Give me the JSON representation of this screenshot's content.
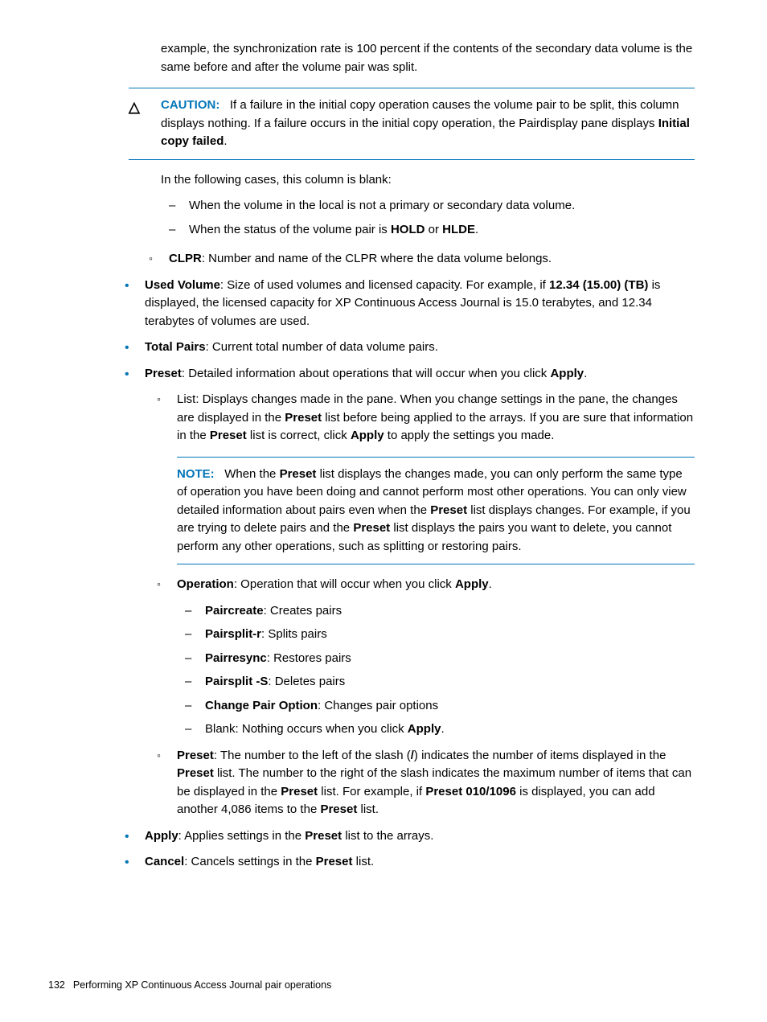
{
  "intro": "example, the synchronization rate is 100 percent if the contents of the secondary data volume is the same before and after the volume pair was split.",
  "caution": {
    "label": "CAUTION:",
    "text1": "If a failure in the initial copy operation causes the volume pair to be split, this column displays nothing. If a failure occurs in the initial copy operation, the Pairdisplay pane displays ",
    "bold1": "Initial copy failed",
    "text2": "."
  },
  "cases": {
    "intro": "In the following cases, this column is blank:",
    "items": [
      "When the volume in the local is not a primary or secondary data volume.",
      {
        "pre": "When the status of the volume pair is ",
        "b1": "HOLD",
        "mid": " or ",
        "b2": "HLDE",
        "post": "."
      }
    ]
  },
  "clpr": {
    "bold": "CLPR",
    "text": ": Number and name of the CLPR where the data volume belongs."
  },
  "usedVol": {
    "b1": "Used Volume",
    "t1": ": Size of used volumes and licensed capacity. For example, if ",
    "b2": "12.34 (15.00) (TB)",
    "t2": " is displayed, the licensed capacity for XP Continuous Access Journal is 15.0 terabytes, and 12.34 terabytes of volumes are used."
  },
  "totalPairs": {
    "b": "Total Pairs",
    "t": ": Current total number of data volume pairs."
  },
  "preset": {
    "b1": "Preset",
    "t1": ": Detailed information about operations that will occur when you click ",
    "b2": "Apply",
    "t2": ".",
    "listItem": {
      "t1": "List: Displays changes made in the pane. When you change settings in the pane, the changes are displayed in the ",
      "b1": "Preset",
      "t2": " list before being applied to the arrays. If you are sure that information in the ",
      "b2": "Preset",
      "t3": " list is correct, click ",
      "b3": "Apply",
      "t4": " to apply the settings you made."
    },
    "note": {
      "label": "NOTE:",
      "t1": "When the ",
      "b1": "Preset",
      "t2": " list displays the changes made, you can only perform the same type of operation you have been doing and cannot perform most other operations. You can only view detailed information about pairs even when the ",
      "b2": "Preset",
      "t3": " list displays changes. For example, if you are trying to delete pairs and the ",
      "b3": "Preset",
      "t4": " list displays the pairs you want to delete, you cannot perform any other operations, such as splitting or restoring pairs."
    },
    "operation": {
      "b1": "Operation",
      "t1": ": Operation that will occur when you click ",
      "b2": "Apply",
      "t2": ".",
      "items": [
        {
          "b": "Paircreate",
          "t": ": Creates pairs"
        },
        {
          "b": "Pairsplit-r",
          "t": ": Splits pairs"
        },
        {
          "b": "Pairresync",
          "t": ": Restores pairs"
        },
        {
          "b": "Pairsplit -S",
          "t": ": Deletes pairs"
        },
        {
          "b": "Change Pair Option",
          "t": ": Changes pair options"
        }
      ],
      "blank": {
        "t1": "Blank: Nothing occurs when you click ",
        "b": "Apply",
        "t2": "."
      }
    },
    "presetNum": {
      "b1": "Preset",
      "t1": ": The number to the left of the slash (",
      "b2": "/",
      "t2": ") indicates the number of items displayed in the ",
      "b3": "Preset",
      "t3": " list. The number to the right of the slash indicates the maximum number of items that can be displayed in the ",
      "b4": "Preset",
      "t4": " list. For example, if ",
      "b5": "Preset 010/1096",
      "t5": " is displayed, you can add another 4,086 items to the ",
      "b6": "Preset",
      "t6": " list."
    }
  },
  "apply": {
    "b1": "Apply",
    "t1": ": Applies settings in the ",
    "b2": "Preset",
    "t2": " list to the arrays."
  },
  "cancel": {
    "b1": "Cancel",
    "t1": ": Cancels settings in the ",
    "b2": "Preset",
    "t2": " list."
  },
  "footer": {
    "page": "132",
    "title": "Performing XP Continuous Access Journal pair operations"
  }
}
